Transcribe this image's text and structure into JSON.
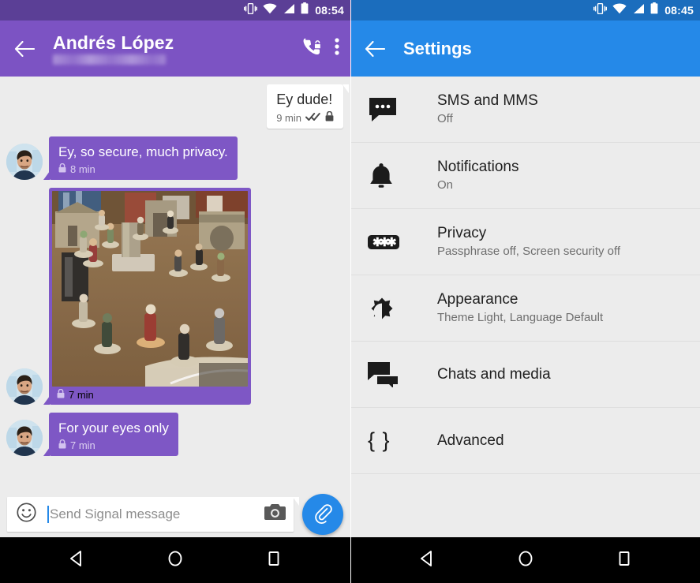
{
  "left_panel": {
    "status_bar": {
      "time": "08:54",
      "icons": [
        "vibrate-icon",
        "wifi-icon",
        "signal-icon",
        "battery-icon"
      ]
    },
    "app_bar": {
      "back_icon": "arrow-back-icon",
      "contact_name": "Andrés López",
      "contact_subtitle": "",
      "call_icon": "secure-call-icon",
      "overflow_icon": "overflow-menu-icon"
    },
    "messages": [
      {
        "id": "m1",
        "direction": "outgoing",
        "text": "Ey dude!",
        "time": "9 min",
        "delivery": "read",
        "lock": "lock-icon"
      },
      {
        "id": "m2",
        "direction": "incoming",
        "text": "Ey, so secure, much privacy.",
        "time": "8 min",
        "lock": "lock-icon"
      },
      {
        "id": "m3",
        "direction": "incoming",
        "type": "image",
        "text": "",
        "time": "7 min",
        "lock": "lock-icon"
      },
      {
        "id": "m4",
        "direction": "incoming",
        "text": "For your eyes only",
        "time": "7 min",
        "lock": "lock-icon"
      }
    ],
    "compose": {
      "emoji_icon": "emoji-smiley-icon",
      "placeholder": "Send Signal message",
      "value": "",
      "camera_icon": "camera-icon",
      "attach_icon": "paperclip-icon"
    }
  },
  "right_panel": {
    "status_bar": {
      "time": "08:45",
      "icons": [
        "vibrate-icon",
        "wifi-icon",
        "signal-icon",
        "battery-icon"
      ]
    },
    "app_bar": {
      "back_icon": "arrow-back-icon",
      "title": "Settings"
    },
    "settings_items": [
      {
        "icon": "sms-bubble-icon",
        "title": "SMS and MMS",
        "subtitle": "Off"
      },
      {
        "icon": "bell-icon",
        "title": "Notifications",
        "subtitle": "On"
      },
      {
        "icon": "passphrase-icon",
        "title": "Privacy",
        "subtitle": "Passphrase off, Screen security off"
      },
      {
        "icon": "brightness-icon",
        "title": "Appearance",
        "subtitle": "Theme Light, Language Default"
      },
      {
        "icon": "forum-icon",
        "title": "Chats and media",
        "subtitle": ""
      },
      {
        "icon": "curly-braces-icon",
        "title": "Advanced",
        "subtitle": "",
        "glyph": "{ }"
      }
    ]
  },
  "nav_bar": {
    "back_icon": "android-back-icon",
    "home_icon": "android-home-icon",
    "recents_icon": "android-recents-icon"
  },
  "colors": {
    "purple_appbar": "#7c53c3",
    "purple_status": "#5b3f96",
    "blue_appbar": "#2589e8",
    "blue_status": "#1b6dbd",
    "bubble_incoming": "#7e57c5",
    "bubble_outgoing": "#ffffff",
    "background": "#ececec",
    "nav_bar": "#000000"
  }
}
